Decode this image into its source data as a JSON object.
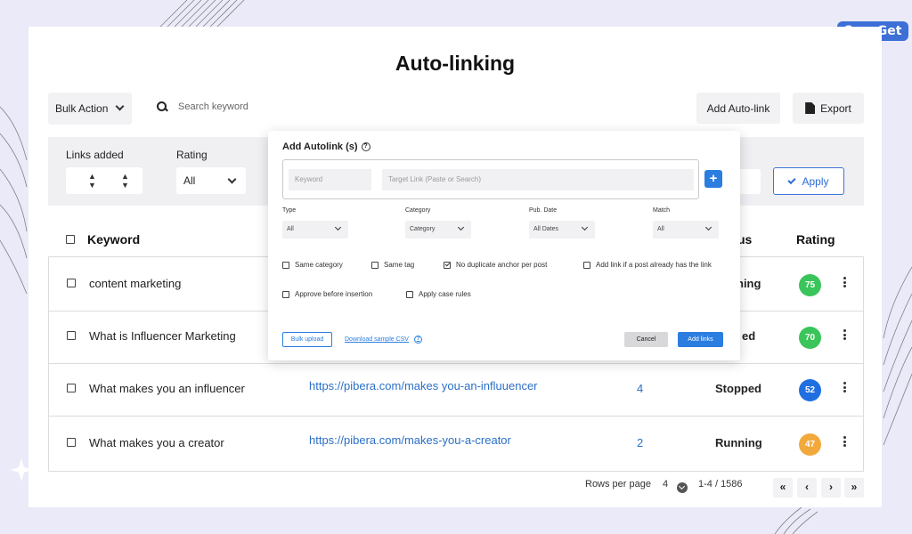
{
  "brand": {
    "name": "SaasGet"
  },
  "page": {
    "title": "Auto-linking"
  },
  "toolbar": {
    "bulk_action_label": "Bulk Action",
    "search_placeholder": "Search keyword",
    "add_autolink_label": "Add Auto-link",
    "export_label": "Export"
  },
  "filters": {
    "links_added_label": "Links added",
    "rating_label": "Rating",
    "rating_value": "All",
    "apply_label": "Apply"
  },
  "table": {
    "headers": {
      "keyword": "Keyword",
      "status": "us",
      "rating": "Rating"
    },
    "rows": [
      {
        "keyword": "content marketing",
        "link": "",
        "count": "",
        "status": "ning",
        "rating": "75",
        "rating_color": "#3ac55a"
      },
      {
        "keyword": "What is Influencer Marketing",
        "link": "",
        "count": "",
        "status": "ed",
        "rating": "70",
        "rating_color": "#3ac55a"
      },
      {
        "keyword": "What makes you an influencer",
        "link": "https://pibera.com/makes you-an-influuencer",
        "count": "4",
        "status": "Stopped",
        "rating": "52",
        "rating_color": "#1f6fe0"
      },
      {
        "keyword": "What makes you a creator",
        "link": "https://pibera.com/makes-you-a-creator",
        "count": "2",
        "status": "Running",
        "rating": "47",
        "rating_color": "#f2a93b"
      }
    ]
  },
  "pagination": {
    "rows_per_page_label": "Rows per page",
    "rows_per_page_value": "4",
    "range": "1-4 / 1586",
    "first": "«",
    "prev": "‹",
    "next": "›",
    "last": "»"
  },
  "modal": {
    "title": "Add Autolink (s)",
    "help_glyph": "?",
    "keyword_placeholder": "Keyword",
    "target_placeholder": "Target Link (Paste or Search)",
    "plus": "+",
    "type_label": "Type",
    "type_value": "All",
    "category_label": "Category",
    "category_value": "Category",
    "pub_date_label": "Pub. Date",
    "pub_date_value": "All Dates",
    "match_label": "Match",
    "match_value": "All",
    "options": {
      "same_category": "Same category",
      "same_tag": "Same tag",
      "no_duplicate": "No duplicate anchor per post",
      "add_if_exists": "Add link if a post already has the link",
      "approve_before": "Approve before insertion",
      "apply_case": "Apply case rules"
    },
    "bulk_upload": "Bulk upload",
    "download_csv": "Download sample CSV",
    "cancel": "Cancel",
    "add_links": "Add links"
  }
}
